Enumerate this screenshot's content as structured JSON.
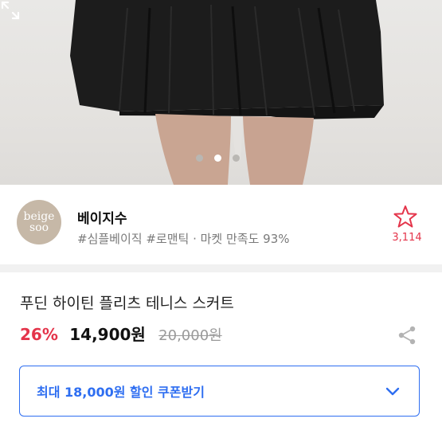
{
  "hero": {
    "image": "product photo: black pleated tennis skirt on model",
    "carousel_dots": 3,
    "active_dot": 2
  },
  "shop": {
    "logo_line1": "beige",
    "logo_line2": "soo",
    "name": "베이지수",
    "tags": "#심플베이직 #로맨틱 · 마켓 만족도 93%",
    "favorite_count": "3,114"
  },
  "product": {
    "title": "푸딘 하이틴 플리츠 테니스 스커트",
    "discount": "26%",
    "price": "14,900원",
    "original_price": "20,000원"
  },
  "coupon": {
    "label": "최대 18,000원 할인 쿠폰받기"
  },
  "colors": {
    "accent_blue": "#2e6ef1",
    "discount_red": "#e4344a",
    "logo_beige": "#c6b8a7"
  }
}
